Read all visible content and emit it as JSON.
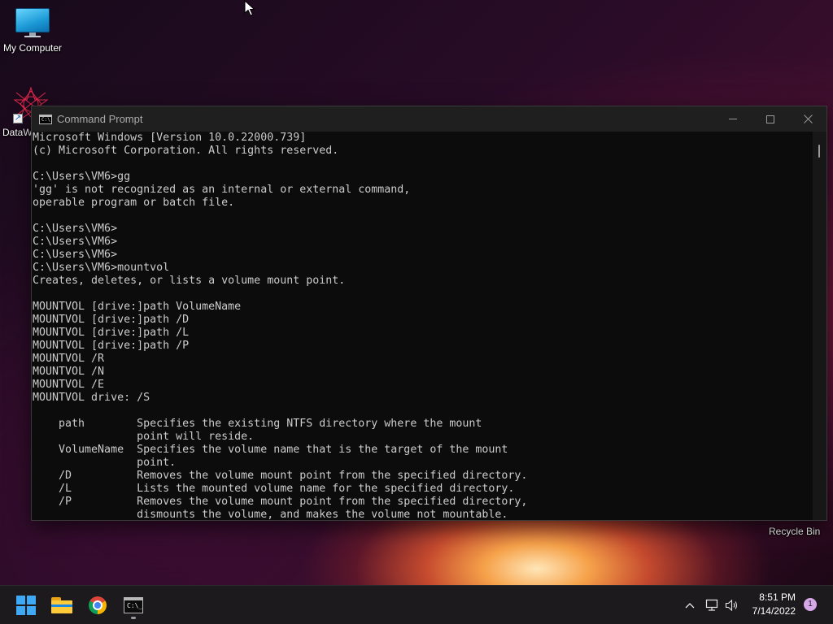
{
  "desktop": {
    "icons": [
      {
        "label": "My Computer",
        "icon": "computer-icon"
      },
      {
        "label": "DataW",
        "icon": "app-shortcut-icon"
      }
    ],
    "recycle_bin_label": "Recycle Bin"
  },
  "window": {
    "title": "Command Prompt",
    "icon": "cmd-icon",
    "icon_glyph": "C:\\"
  },
  "console": {
    "lines": [
      "Microsoft Windows [Version 10.0.22000.739]",
      "(c) Microsoft Corporation. All rights reserved.",
      "",
      "C:\\Users\\VM6>gg",
      "'gg' is not recognized as an internal or external command,",
      "operable program or batch file.",
      "",
      "C:\\Users\\VM6>",
      "C:\\Users\\VM6>",
      "C:\\Users\\VM6>",
      "C:\\Users\\VM6>mountvol",
      "Creates, deletes, or lists a volume mount point.",
      "",
      "MOUNTVOL [drive:]path VolumeName",
      "MOUNTVOL [drive:]path /D",
      "MOUNTVOL [drive:]path /L",
      "MOUNTVOL [drive:]path /P",
      "MOUNTVOL /R",
      "MOUNTVOL /N",
      "MOUNTVOL /E",
      "MOUNTVOL drive: /S",
      "",
      "    path        Specifies the existing NTFS directory where the mount",
      "                point will reside.",
      "    VolumeName  Specifies the volume name that is the target of the mount",
      "                point.",
      "    /D          Removes the volume mount point from the specified directory.",
      "    /L          Lists the mounted volume name for the specified directory.",
      "    /P          Removes the volume mount point from the specified directory,",
      "                dismounts the volume, and makes the volume not mountable."
    ]
  },
  "taskbar": {
    "apps": [
      {
        "name": "Start",
        "icon": "windows-start-icon"
      },
      {
        "name": "File Explorer",
        "icon": "folder-icon"
      },
      {
        "name": "Google Chrome",
        "icon": "chrome-icon"
      },
      {
        "name": "Command Prompt",
        "icon": "cmd-icon",
        "icon_glyph": "C:\\_",
        "active": true
      }
    ],
    "clock": {
      "time": "8:51 PM",
      "date": "7/14/2022"
    },
    "notification_count": "1"
  },
  "colors": {
    "console_bg": "#0c0c0c",
    "console_text": "#cccccc",
    "titlebar_bg": "#1f1f1f",
    "taskbar_bg": "#1c1a1d",
    "start_accent": "#3fa9f5"
  }
}
